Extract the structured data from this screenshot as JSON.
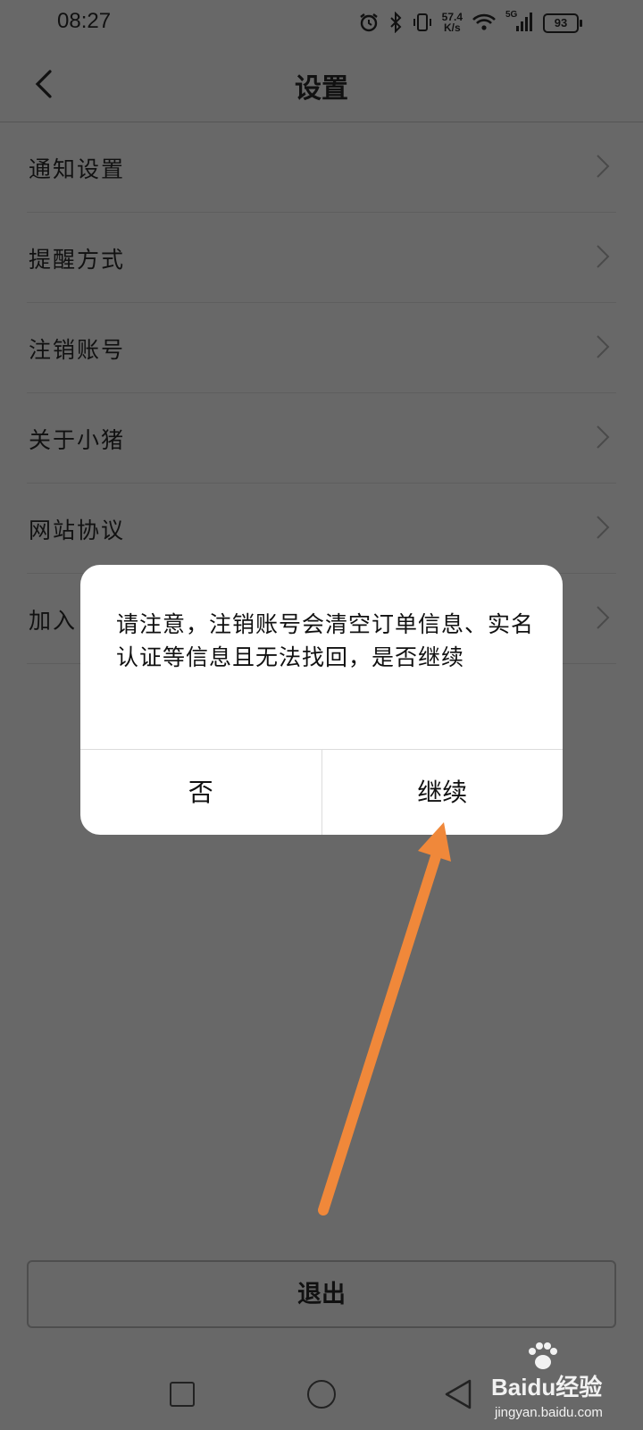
{
  "status_bar": {
    "time": "08:27",
    "net_speed_value": "57.4",
    "net_speed_unit": "K/s",
    "signal_label": "5G",
    "battery": "93"
  },
  "header": {
    "title": "设置"
  },
  "settings_items": [
    {
      "label": "通知设置"
    },
    {
      "label": "提醒方式"
    },
    {
      "label": "注销账号"
    },
    {
      "label": "关于小猪"
    },
    {
      "label": "网站协议"
    },
    {
      "label": "加入"
    }
  ],
  "logout": {
    "label": "退出"
  },
  "dialog": {
    "message": "请注意，注销账号会清空订单信息、实名认证等信息且无法找回，是否继续",
    "cancel_label": "否",
    "confirm_label": "继续"
  },
  "watermark": {
    "brand": "Baidu经验",
    "url": "jingyan.baidu.com"
  },
  "colors": {
    "overlay_background": "#686868",
    "dialog_background": "#ffffff",
    "annotation_arrow": "#f0883a"
  }
}
